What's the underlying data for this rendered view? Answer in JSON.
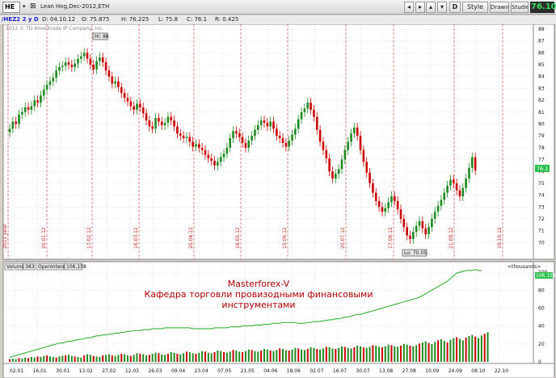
{
  "toolbar": {
    "symbol": "HE",
    "instrument": "Lean Hog,Dec-2012,ETH",
    "price": "76.10",
    "style_label": "Style",
    "drawings_label": "Drawings",
    "studies_label": "Studies",
    "d_label": "D"
  },
  "quote": {
    "symbol": "/HEZ2 2 y D",
    "date": "D: 04.10.12",
    "open": "O: 75.875",
    "high": "H: 76.225",
    "low": "L: 75.8",
    "close": "C: 76.1",
    "range": "R: 0.425",
    "copyright": "2012 © TD Ameritrade IP Company, Inc."
  },
  "chart_data": {
    "type": "candlestick",
    "ylim": [
      69,
      88
    ],
    "yticks": [
      "88",
      "87",
      "86",
      "85",
      "84",
      "83",
      "82",
      "81",
      "80",
      "79",
      "78",
      "77",
      "76",
      "75",
      "74",
      "73",
      "72",
      "71",
      "70"
    ],
    "x_labels": [
      "02.01",
      "16.01",
      "30.01",
      "13.02",
      "27.02",
      "12.03",
      "26.03",
      "09.04",
      "23.04",
      "07.05",
      "21.05",
      "04.06",
      "18.06",
      "02.07",
      "16.07",
      "30.07",
      "13.08",
      "27.08",
      "10.09",
      "24.09",
      "08.10",
      "22.10"
    ],
    "vlines": [
      "2011 year",
      "20.01.12",
      "17.02.12",
      "16.03.12",
      "20.04.12",
      "18.05.12",
      "15.06.12",
      "20.07.12",
      "17.08.12",
      "21.09.12",
      "19.10.12"
    ],
    "high_marker": "Hi: 86",
    "low_marker": "Lo: 70.05",
    "last_price_tag": "76.1",
    "series": [
      {
        "name": "Lean Hog",
        "close": [
          79.6,
          80.2,
          80.0,
          80.8,
          81.0,
          81.4,
          81.2,
          81.5,
          82.0,
          81.8,
          82.4,
          82.9,
          83.3,
          83.6,
          83.9,
          84.5,
          84.8,
          84.9,
          85.2,
          85.0,
          84.8,
          85.1,
          85.5,
          85.7,
          86.0,
          85.5,
          85.0,
          84.6,
          85.3,
          85.6,
          85.2,
          84.5,
          84.0,
          83.4,
          83.6,
          83.1,
          82.6,
          82.2,
          81.9,
          81.5,
          81.2,
          81.7,
          81.4,
          80.9,
          80.3,
          79.8,
          79.6,
          80.5,
          80.2,
          79.9,
          80.1,
          80.6,
          80.3,
          79.8,
          79.2,
          79.0,
          78.8,
          78.9,
          78.5,
          78.1,
          78.3,
          78.0,
          77.8,
          77.4,
          77.1,
          76.9,
          76.5,
          76.8,
          77.2,
          77.5,
          78.0,
          78.8,
          79.4,
          79.2,
          78.9,
          78.4,
          78.0,
          78.6,
          79.0,
          79.5,
          79.9,
          80.3,
          80.1,
          79.8,
          80.2,
          79.6,
          79.0,
          78.8,
          78.4,
          78.1,
          78.6,
          79.1,
          79.6,
          80.4,
          81.0,
          81.3,
          81.8,
          81.2,
          80.6,
          79.5,
          78.5,
          77.8,
          77.1,
          76.0,
          75.4,
          75.8,
          76.2,
          77.0,
          77.8,
          78.5,
          79.2,
          79.7,
          79.0,
          77.8,
          76.8,
          75.9,
          75.0,
          74.2,
          73.5,
          73.0,
          72.6,
          72.9,
          73.4,
          73.9,
          73.5,
          72.8,
          72.0,
          71.3,
          70.6,
          70.3,
          70.9,
          71.4,
          71.8,
          71.2,
          70.7,
          71.3,
          72.0,
          72.6,
          73.1,
          73.6,
          74.2,
          74.8,
          75.3,
          75.0,
          74.4,
          73.9,
          74.6,
          75.4,
          76.3,
          77.2,
          76.1
        ]
      },
      {
        "name": "Volume",
        "values": [
          5,
          6,
          5,
          7,
          6,
          8,
          7,
          9,
          8,
          10,
          9,
          11,
          12,
          10,
          9,
          8,
          10,
          11,
          12,
          13,
          11,
          10,
          9,
          8,
          12,
          14,
          13,
          11,
          10,
          9,
          12,
          13,
          14,
          12,
          11,
          13,
          15,
          14,
          12,
          11,
          13,
          16,
          15,
          14,
          12,
          13,
          15,
          17,
          16,
          14,
          13,
          15,
          18,
          17,
          15,
          14,
          16,
          19,
          18,
          16,
          15,
          17,
          20,
          19,
          17,
          16,
          18,
          21,
          20,
          18,
          17,
          19,
          22,
          21,
          19,
          18,
          20,
          23,
          22,
          20,
          19,
          21,
          24,
          23,
          21,
          20,
          22,
          25,
          24,
          22,
          21,
          23,
          26,
          25,
          23,
          22,
          24,
          27,
          26,
          24,
          23,
          25,
          28,
          27,
          25,
          24,
          26,
          29,
          28,
          26,
          25,
          27,
          30,
          29,
          27,
          26,
          28,
          31,
          30,
          28,
          27,
          29,
          32,
          31,
          29,
          28,
          30,
          33,
          32,
          30,
          29,
          31,
          34,
          36,
          38,
          35,
          33,
          37,
          40,
          42,
          39,
          36,
          41,
          44,
          46,
          43,
          40,
          45,
          48,
          50,
          47,
          44,
          49,
          52,
          55
        ]
      },
      {
        "name": "OpenInterest",
        "values": [
          5,
          6,
          7,
          8,
          9,
          10,
          11,
          12,
          13,
          14,
          15,
          16,
          17,
          18,
          19,
          20,
          21,
          21,
          22,
          23,
          23,
          24,
          25,
          25,
          26,
          27,
          27,
          28,
          29,
          29,
          30,
          30,
          31,
          31,
          32,
          32,
          33,
          33,
          34,
          34,
          35,
          35,
          35,
          36,
          36,
          36,
          37,
          37,
          37,
          37,
          38,
          38,
          38,
          38,
          38,
          38,
          38,
          38,
          38,
          37,
          37,
          37,
          37,
          37,
          37,
          37,
          38,
          38,
          38,
          38,
          38,
          39,
          39,
          39,
          39,
          40,
          40,
          40,
          40,
          41,
          41,
          41,
          42,
          42,
          42,
          43,
          43,
          43,
          44,
          44,
          44,
          44,
          44,
          43,
          43,
          43,
          44,
          44,
          45,
          45,
          45,
          46,
          46,
          47,
          47,
          48,
          48,
          49,
          50,
          50,
          51,
          52,
          53,
          53,
          54,
          55,
          56,
          57,
          58,
          59,
          60,
          61,
          62,
          63,
          64,
          65,
          66,
          67,
          68,
          69,
          70,
          71,
          72,
          74,
          76,
          78,
          80,
          82,
          84,
          86,
          88,
          90,
          93,
          96,
          99,
          100,
          101,
          102,
          102,
          102,
          103,
          102,
          102
        ]
      }
    ],
    "lower_ylim": [
      0,
      110
    ],
    "lower_yticks": [
      "100",
      "80",
      "60",
      "40",
      "20",
      "0"
    ]
  },
  "lower": {
    "volume_label": "Volume",
    "volume_value": "383",
    "oi_label": "OpenInterest",
    "oi_value": "106,158",
    "units_label": "<thousands>",
    "oi_tag": "106.158"
  },
  "overlay": {
    "line1": "Masterforex-V",
    "line2": "Кафедра торговли провизодными финансовыми",
    "line3": "инструментами"
  },
  "colors": {
    "up": "#1e8a1e",
    "down": "#cc0000",
    "grid": "#c8c8c8",
    "vline": "#cc3333",
    "oi": "#22aa22",
    "overlay_text": "#b00000"
  }
}
